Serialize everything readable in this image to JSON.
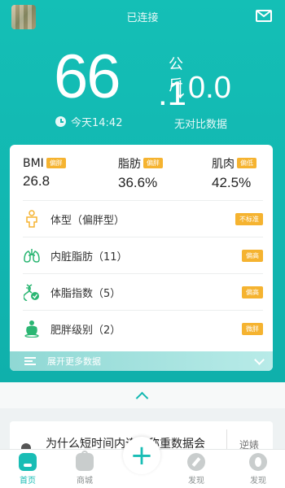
{
  "header": {
    "status": "已连接"
  },
  "weight": {
    "integer": "66",
    "decimal": ".1",
    "unit": "公斤",
    "time": "今天14:42"
  },
  "delta": {
    "value": "↓0.0",
    "note": "无对比数据"
  },
  "metrics": [
    {
      "name": "BMI",
      "badge": "偏胖",
      "value": "26.8"
    },
    {
      "name": "脂肪",
      "badge": "偏胖",
      "value": "36.6%"
    },
    {
      "name": "肌肉",
      "badge": "偏低",
      "value": "42.5%"
    }
  ],
  "rows": [
    {
      "label": "体型（偏胖型）",
      "tag": "不标准",
      "icon": "body-type-icon"
    },
    {
      "label": "内脏脂肪（11）",
      "tag": "偏高",
      "icon": "lungs-icon"
    },
    {
      "label": "体脂指数（5）",
      "tag": "偏高",
      "icon": "dna-icon"
    },
    {
      "label": "肥胖级别（2）",
      "tag": "微胖",
      "icon": "obesity-icon"
    }
  ],
  "more": {
    "label": "展开更多数据"
  },
  "article": {
    "title": "为什么短时间内连续称重数据会",
    "side": "逆婊"
  },
  "tabs": [
    {
      "label": "首页",
      "active": true
    },
    {
      "label": "商城",
      "active": false
    },
    {
      "label": "发现",
      "active": false
    },
    {
      "label": "发现",
      "active": false
    }
  ],
  "colors": {
    "brand": "#14bfb6",
    "badge": "#f5b330"
  }
}
